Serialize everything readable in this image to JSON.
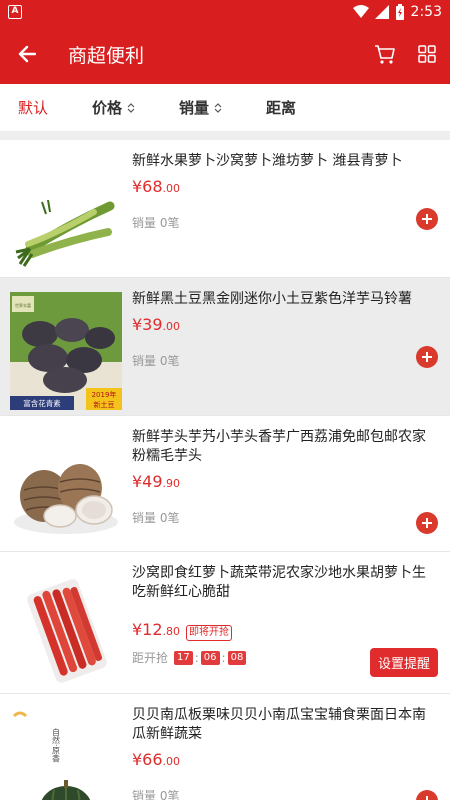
{
  "status": {
    "time": "2:53",
    "app_badge": "A"
  },
  "header": {
    "title": "商超便利"
  },
  "filters": [
    {
      "label": "默认",
      "active": true
    },
    {
      "label": "价格"
    },
    {
      "label": "销量"
    },
    {
      "label": "距离"
    }
  ],
  "products": [
    {
      "name": "新鲜水果萝卜沙窝萝卜潍坊萝卜 潍县青萝卜",
      "price_int": "¥68",
      "price_dec": ".00",
      "sales": "销量 0笔"
    },
    {
      "name": "新鲜黑土豆黑金刚迷你小土豆紫色洋芋马铃薯",
      "price_int": "¥39",
      "price_dec": ".00",
      "sales": "销量 0笔",
      "img_top": "富含花青素",
      "img_year": "2019年",
      "img_sub": "新土豆",
      "img_brand": "世界丰富"
    },
    {
      "name": "新鲜芋头芋艿小芋头香芋广西荔浦免邮包邮农家粉糯毛芋头",
      "price_int": "¥49",
      "price_dec": ".90",
      "sales": "销量 0笔"
    },
    {
      "name": "沙窝即食红萝卜蔬菜带泥农家沙地水果胡萝卜生吃新鲜红心脆甜",
      "price_int": "¥12",
      "price_dec": ".80",
      "tag": "即将开抢",
      "countdown_label": "距开抢",
      "cd_h": "17",
      "cd_m": "06",
      "cd_s": "08",
      "remind": "设置提醒"
    },
    {
      "name": "贝贝南瓜板栗味贝贝小南瓜宝宝辅食栗面日本南瓜新鲜蔬菜",
      "price_int": "¥66",
      "price_dec": ".00",
      "sales": "销量 0笔",
      "img_text": "自然·原香"
    }
  ]
}
